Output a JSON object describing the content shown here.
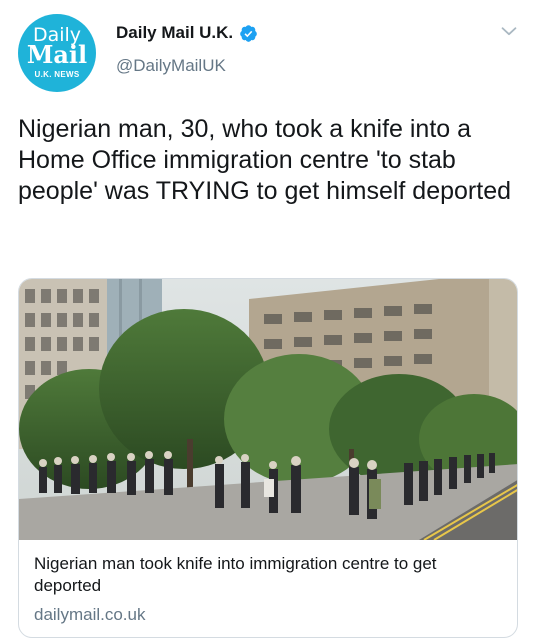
{
  "account": {
    "avatar_line1": "Daily",
    "avatar_line2": "Mail",
    "avatar_line3": "U.K. NEWS",
    "display_name": "Daily Mail U.K.",
    "handle": "@DailyMailUK",
    "verified": true
  },
  "tweet": {
    "text": "Nigerian man, 30, who took a knife into a Home Office immigration centre 'to stab people' was TRYING to get himself deported"
  },
  "card": {
    "image_description": "street-scene-photo",
    "title": "Nigerian man took knife into immigration centre to get deported",
    "domain": "dailymail.co.uk"
  },
  "colors": {
    "avatar_bg": "#1fb3d9",
    "verified_blue": "#1da1f2",
    "secondary_text": "#657786",
    "border": "#d4dbe1"
  },
  "icons": {
    "verified": "verified-badge-icon",
    "menu": "chevron-down-icon"
  }
}
